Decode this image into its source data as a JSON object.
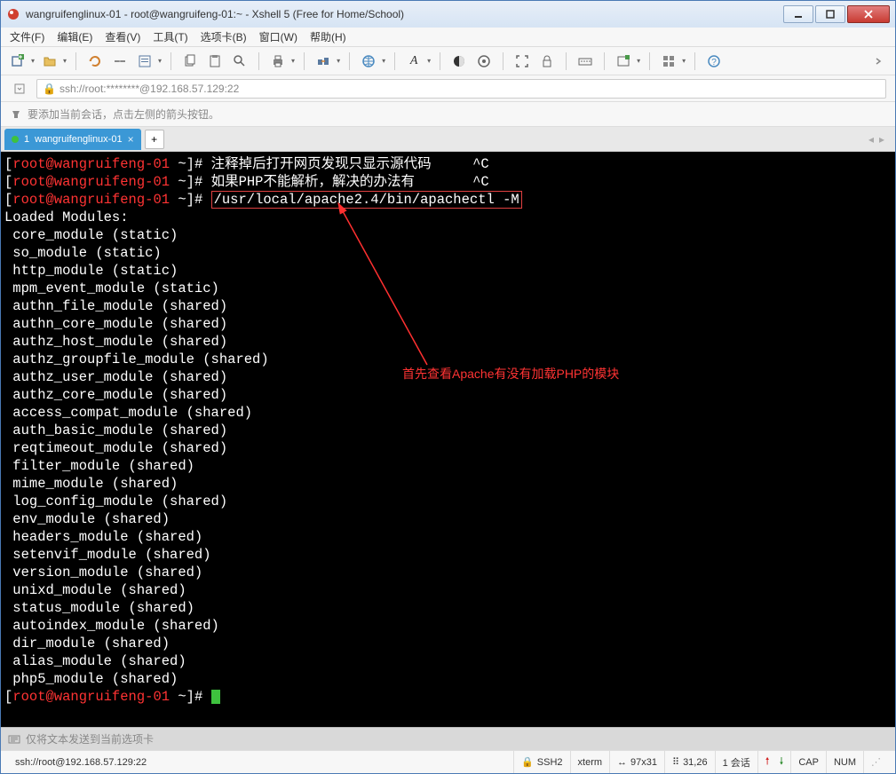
{
  "window": {
    "title": "wangruifenglinux-01 - root@wangruifeng-01:~ - Xshell 5 (Free for Home/School)"
  },
  "menu": {
    "file": "文件(F)",
    "edit": "编辑(E)",
    "view": "查看(V)",
    "tools": "工具(T)",
    "tabs": "选项卡(B)",
    "window": "窗口(W)",
    "help": "帮助(H)"
  },
  "address": {
    "url": "ssh://root:********@192.168.57.129:22"
  },
  "hint": {
    "text": "要添加当前会话，点击左侧的箭头按钮。"
  },
  "tab": {
    "index": "1",
    "label": "wangruifenglinux-01"
  },
  "terminal": {
    "prompt_user": "root",
    "prompt_host": "wangruifeng-01",
    "prompt_path": "~",
    "lines": [
      {
        "cmd": "注释掉后打开网页发现只显示源代码",
        "tail": "     ^C"
      },
      {
        "cmd": "如果PHP不能解析，解决的办法有",
        "tail": "       ^C"
      },
      {
        "cmd_highlight": "/usr/local/apache2.4/bin/apachectl -M"
      }
    ],
    "output": [
      "Loaded Modules:",
      " core_module (static)",
      " so_module (static)",
      " http_module (static)",
      " mpm_event_module (static)",
      " authn_file_module (shared)",
      " authn_core_module (shared)",
      " authz_host_module (shared)",
      " authz_groupfile_module (shared)",
      " authz_user_module (shared)",
      " authz_core_module (shared)",
      " access_compat_module (shared)",
      " auth_basic_module (shared)",
      " reqtimeout_module (shared)",
      " filter_module (shared)",
      " mime_module (shared)",
      " log_config_module (shared)",
      " env_module (shared)",
      " headers_module (shared)",
      " setenvif_module (shared)",
      " version_module (shared)",
      " unixd_module (shared)",
      " status_module (shared)",
      " autoindex_module (shared)",
      " dir_module (shared)",
      " alias_module (shared)",
      " php5_module (shared)"
    ],
    "annotation": "首先查看Apache有没有加载PHP的模块"
  },
  "inputbar": {
    "text": "仅将文本发送到当前选项卡"
  },
  "status": {
    "conn": "ssh://root@192.168.57.129:22",
    "proto": "SSH2",
    "term": "xterm",
    "size": "97x31",
    "pos": "31,26",
    "sessions": "1 会话",
    "caps": "CAP",
    "num": "NUM"
  }
}
